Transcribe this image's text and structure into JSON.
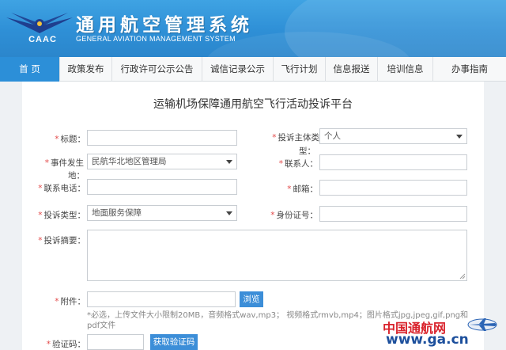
{
  "header": {
    "logo_text": "CAAC",
    "title_cn": "通用航空管理系统",
    "title_en": "GENERAL AVIATION MANAGEMENT SYSTEM"
  },
  "nav": {
    "items": [
      "首 页",
      "政策发布",
      "行政许可公示公告",
      "诚信记录公示",
      "飞行计划",
      "信息报送",
      "培训信息",
      "办事指南"
    ]
  },
  "form": {
    "title": "运输机场保障通用航空飞行活动投诉平台",
    "required_mark": "*",
    "fields": {
      "title_label": "标题：",
      "complainant_type_label_1": "投诉主体类",
      "complainant_type_label_2": "型：",
      "complainant_type_value": "个人",
      "event_location_label_1": "事件发生",
      "event_location_label_2": "地：",
      "event_location_value": "民航华北地区管理局",
      "contact_label": "联系人：",
      "phone_label": "联系电话：",
      "email_label": "邮箱：",
      "complaint_type_label": "投诉类型：",
      "complaint_type_value": "地面服务保障",
      "id_label": "身份证号：",
      "summary_label": "投诉摘要：",
      "attachment_label": "附件：",
      "browse_button": "浏览",
      "attachment_hint_1": "*必选，上传文件大小限制20MB，音频格式wav,mp3； 视频格式rmvb,mp4；图片格式jpg,jpeg,gif,png和",
      "attachment_hint_2": "pdf文件",
      "captcha_label": "验证码：",
      "captcha_button": "获取验证码"
    }
  },
  "watermark": {
    "cn": "中国通航网",
    "url": "www.ga.cn"
  }
}
